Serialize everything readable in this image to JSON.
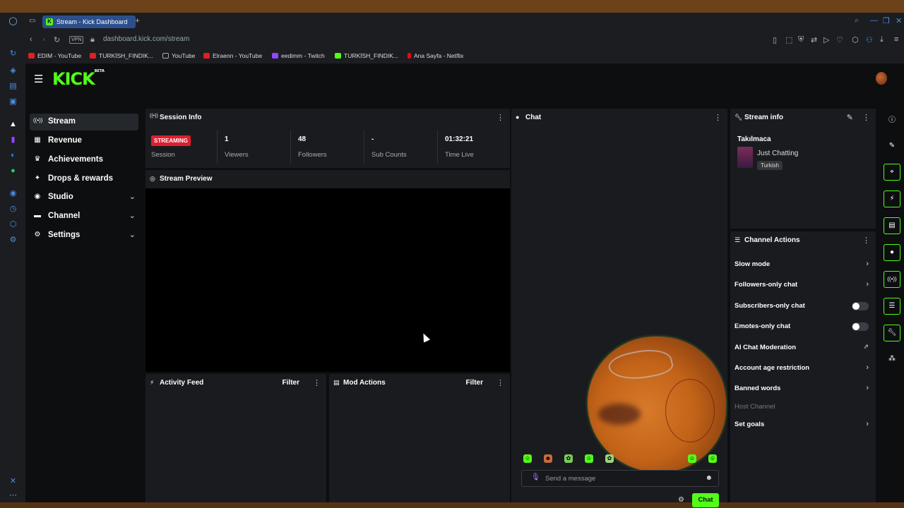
{
  "browser": {
    "tab_title": "Stream - Kick Dashboard",
    "tab_favicon": "K",
    "url": "dashboard.kick.com/stream",
    "vpn_label": "VPN",
    "bookmarks": [
      {
        "label": "EDIM - YouTube",
        "color": "#e02020"
      },
      {
        "label": "TURKİSH_FINDIK...",
        "color": "#e02020"
      },
      {
        "label": "YouTube",
        "color": "#888888"
      },
      {
        "label": "Elraenn - YouTube",
        "color": "#e02020"
      },
      {
        "label": "eedimm - Twitch",
        "color": "#9146ff"
      },
      {
        "label": "TURKİSH_FINDIK...",
        "color": "#53fc18"
      },
      {
        "label": "Ana Sayfa - Netflix",
        "color": "#e50914"
      }
    ]
  },
  "app": {
    "logo": "KICK",
    "logo_badge": "BETA",
    "accent": "#53fc18"
  },
  "nav": {
    "items": [
      {
        "label": "Stream",
        "icon": "broadcast-icon",
        "glyph": "((•))",
        "active": true,
        "chevron": false
      },
      {
        "label": "Revenue",
        "icon": "revenue-icon",
        "glyph": "▦",
        "active": false,
        "chevron": false
      },
      {
        "label": "Achievements",
        "icon": "trophy-icon",
        "glyph": "♛",
        "active": false,
        "chevron": false
      },
      {
        "label": "Drops & rewards",
        "icon": "gift-icon",
        "glyph": "✦",
        "active": false,
        "chevron": false
      },
      {
        "label": "Studio",
        "icon": "studio-icon",
        "glyph": "◉",
        "active": false,
        "chevron": true
      },
      {
        "label": "Channel",
        "icon": "channel-icon",
        "glyph": "▬",
        "active": false,
        "chevron": true
      },
      {
        "label": "Settings",
        "icon": "gear-icon",
        "glyph": "⚙",
        "active": false,
        "chevron": true
      }
    ]
  },
  "session": {
    "title": "Session Info",
    "status_badge": "STREAMING",
    "session_label": "Session",
    "stats": [
      {
        "value": "1",
        "label": "Viewers"
      },
      {
        "value": "48",
        "label": "Followers"
      },
      {
        "value": "-",
        "label": "Sub Counts"
      },
      {
        "value": "01:32:21",
        "label": "Time Live"
      }
    ]
  },
  "preview": {
    "title": "Stream Preview"
  },
  "activity": {
    "title": "Activity Feed",
    "filter": "Filter"
  },
  "mod": {
    "title": "Mod Actions",
    "filter": "Filter"
  },
  "chat": {
    "title": "Chat",
    "placeholder": "Send a message",
    "send_label": "Chat"
  },
  "stream_info": {
    "title": "Stream info",
    "stream_title": "Takılmaca",
    "category": "Just Chatting",
    "language": "Turkish"
  },
  "channel_actions": {
    "title": "Channel Actions",
    "items": [
      {
        "label": "Slow mode",
        "control": "chevron"
      },
      {
        "label": "Followers-only chat",
        "control": "chevron"
      },
      {
        "label": "Subscribers-only chat",
        "control": "toggle"
      },
      {
        "label": "Emotes-only chat",
        "control": "toggle"
      },
      {
        "label": "AI Chat Moderation",
        "control": "external"
      },
      {
        "label": "Account age restriction",
        "control": "chevron"
      },
      {
        "label": "Banned words",
        "control": "chevron"
      },
      {
        "label": "Host Channel",
        "control": "none"
      },
      {
        "label": "Set goals",
        "control": "chevron"
      }
    ]
  }
}
